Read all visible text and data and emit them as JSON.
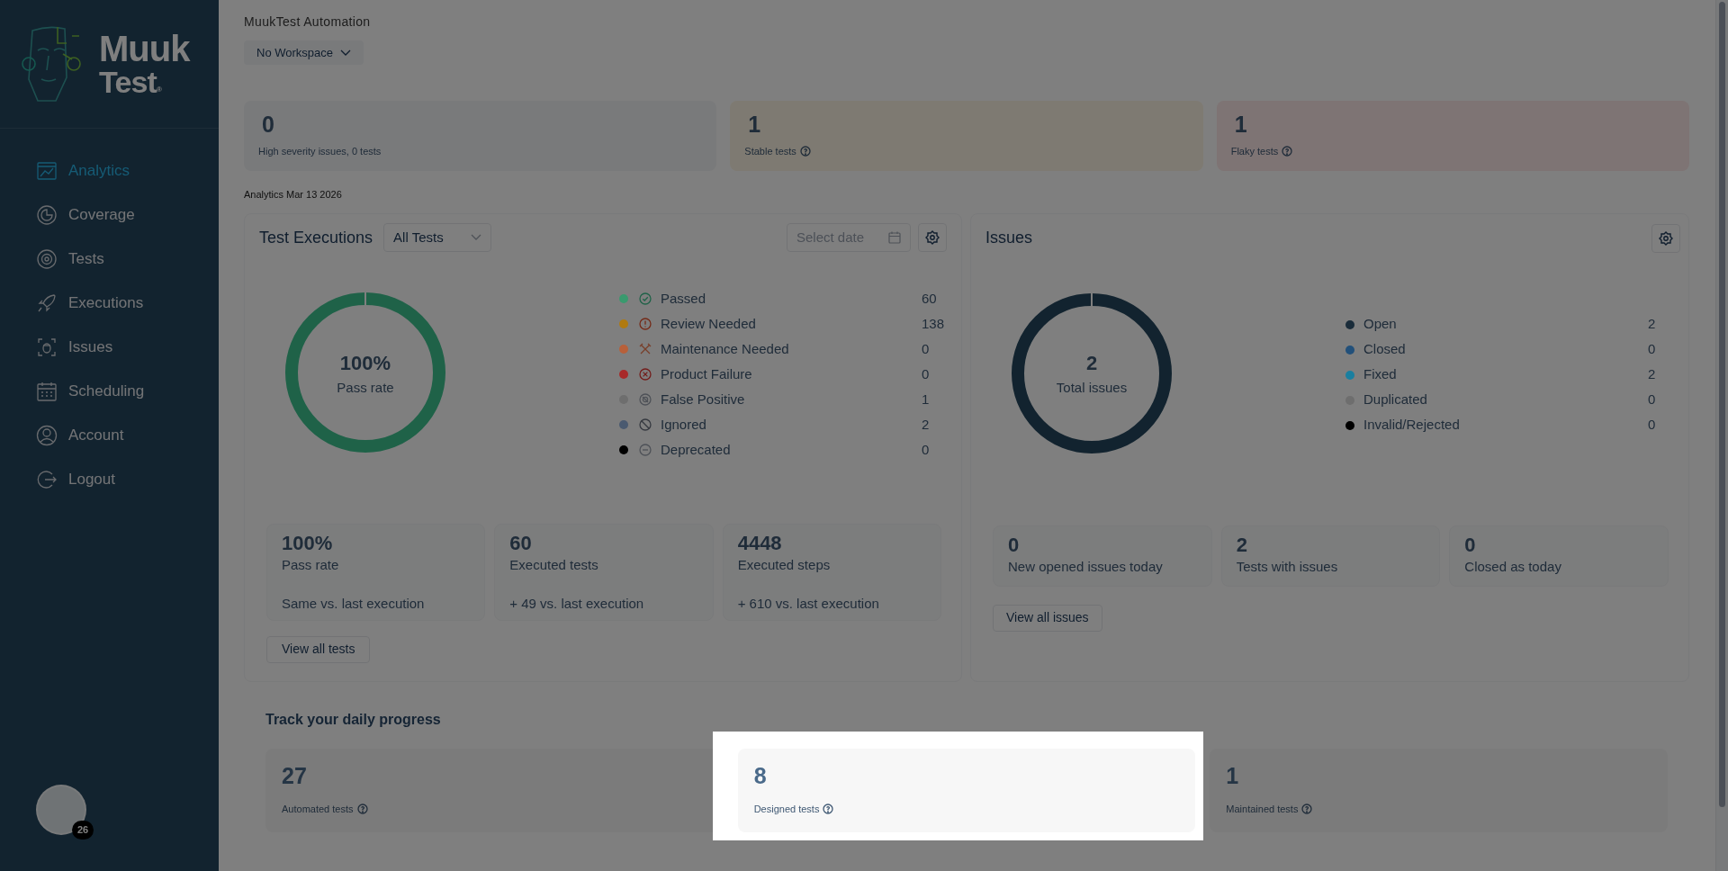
{
  "logo": {
    "line1": "Muuk",
    "line2": "Test",
    "mark": "®"
  },
  "sidebar": {
    "items": [
      {
        "label": "Analytics",
        "selected": true
      },
      {
        "label": "Coverage",
        "selected": false
      },
      {
        "label": "Tests",
        "selected": false
      },
      {
        "label": "Executions",
        "selected": false
      },
      {
        "label": "Issues",
        "selected": false
      },
      {
        "label": "Scheduling",
        "selected": false
      },
      {
        "label": "Account",
        "selected": false
      },
      {
        "label": "Logout",
        "selected": false
      }
    ]
  },
  "user": {
    "badge": "26"
  },
  "app": {
    "title": "MuukTest Automation"
  },
  "workspace": {
    "value": "No Workspace"
  },
  "summary_cards": [
    {
      "value": "0",
      "label": "High severity issues, 0 tests",
      "kind": "neutral",
      "info": false
    },
    {
      "value": "1",
      "label": "Stable tests",
      "kind": "warning",
      "info": true
    },
    {
      "value": "1",
      "label": "Flaky tests",
      "kind": "danger",
      "info": true
    }
  ],
  "analytics_date": "Analytics Mar 13 2026",
  "executions": {
    "title": "Test Executions",
    "filter": "All Tests",
    "date_placeholder": "Select date",
    "donut": {
      "value": "100%",
      "label": "Pass rate"
    },
    "legend": [
      {
        "label": "Passed",
        "value": "60",
        "color": "#3a9a6e"
      },
      {
        "label": "Review Needed",
        "value": "138",
        "color": "#b07a10"
      },
      {
        "label": "Maintenance Needed",
        "value": "0",
        "color": "#b8603a"
      },
      {
        "label": "Product Failure",
        "value": "0",
        "color": "#a82a2a"
      },
      {
        "label": "False Positive",
        "value": "1",
        "color": "#6e6e6e"
      },
      {
        "label": "Ignored",
        "value": "2",
        "color": "#4a5a70"
      },
      {
        "label": "Deprecated",
        "value": "0",
        "color": "#000000"
      }
    ],
    "stats": [
      {
        "value": "100%",
        "label": "Pass rate",
        "comparison": "Same vs. last execution"
      },
      {
        "value": "60",
        "label": "Executed tests",
        "comparison": "+ 49 vs. last execution"
      },
      {
        "value": "4448",
        "label": "Executed steps",
        "comparison": "+ 610 vs. last execution"
      }
    ],
    "button": "View all tests"
  },
  "issues": {
    "title": "Issues",
    "donut": {
      "value": "2",
      "label": "Total issues"
    },
    "legend": [
      {
        "label": "Open",
        "value": "2",
        "color": "#1a2c3a"
      },
      {
        "label": "Closed",
        "value": "0",
        "color": "#22507a"
      },
      {
        "label": "Fixed",
        "value": "2",
        "color": "#1a7fa0"
      },
      {
        "label": "Duplicated",
        "value": "0",
        "color": "#6e6e6e"
      },
      {
        "label": "Invalid/Rejected",
        "value": "0",
        "color": "#000000"
      }
    ],
    "stats": [
      {
        "value": "0",
        "label": "New opened issues today"
      },
      {
        "value": "2",
        "label": "Tests with issues"
      },
      {
        "value": "0",
        "label": "Closed as today"
      }
    ],
    "button": "View all issues"
  },
  "daily_progress": {
    "title": "Track your daily progress",
    "cards": [
      {
        "value": "27",
        "label": "Automated tests",
        "highlighted": false
      },
      {
        "value": "8",
        "label": "Designed tests",
        "highlighted": true
      },
      {
        "value": "1",
        "label": "Maintained tests",
        "highlighted": false
      }
    ]
  }
}
